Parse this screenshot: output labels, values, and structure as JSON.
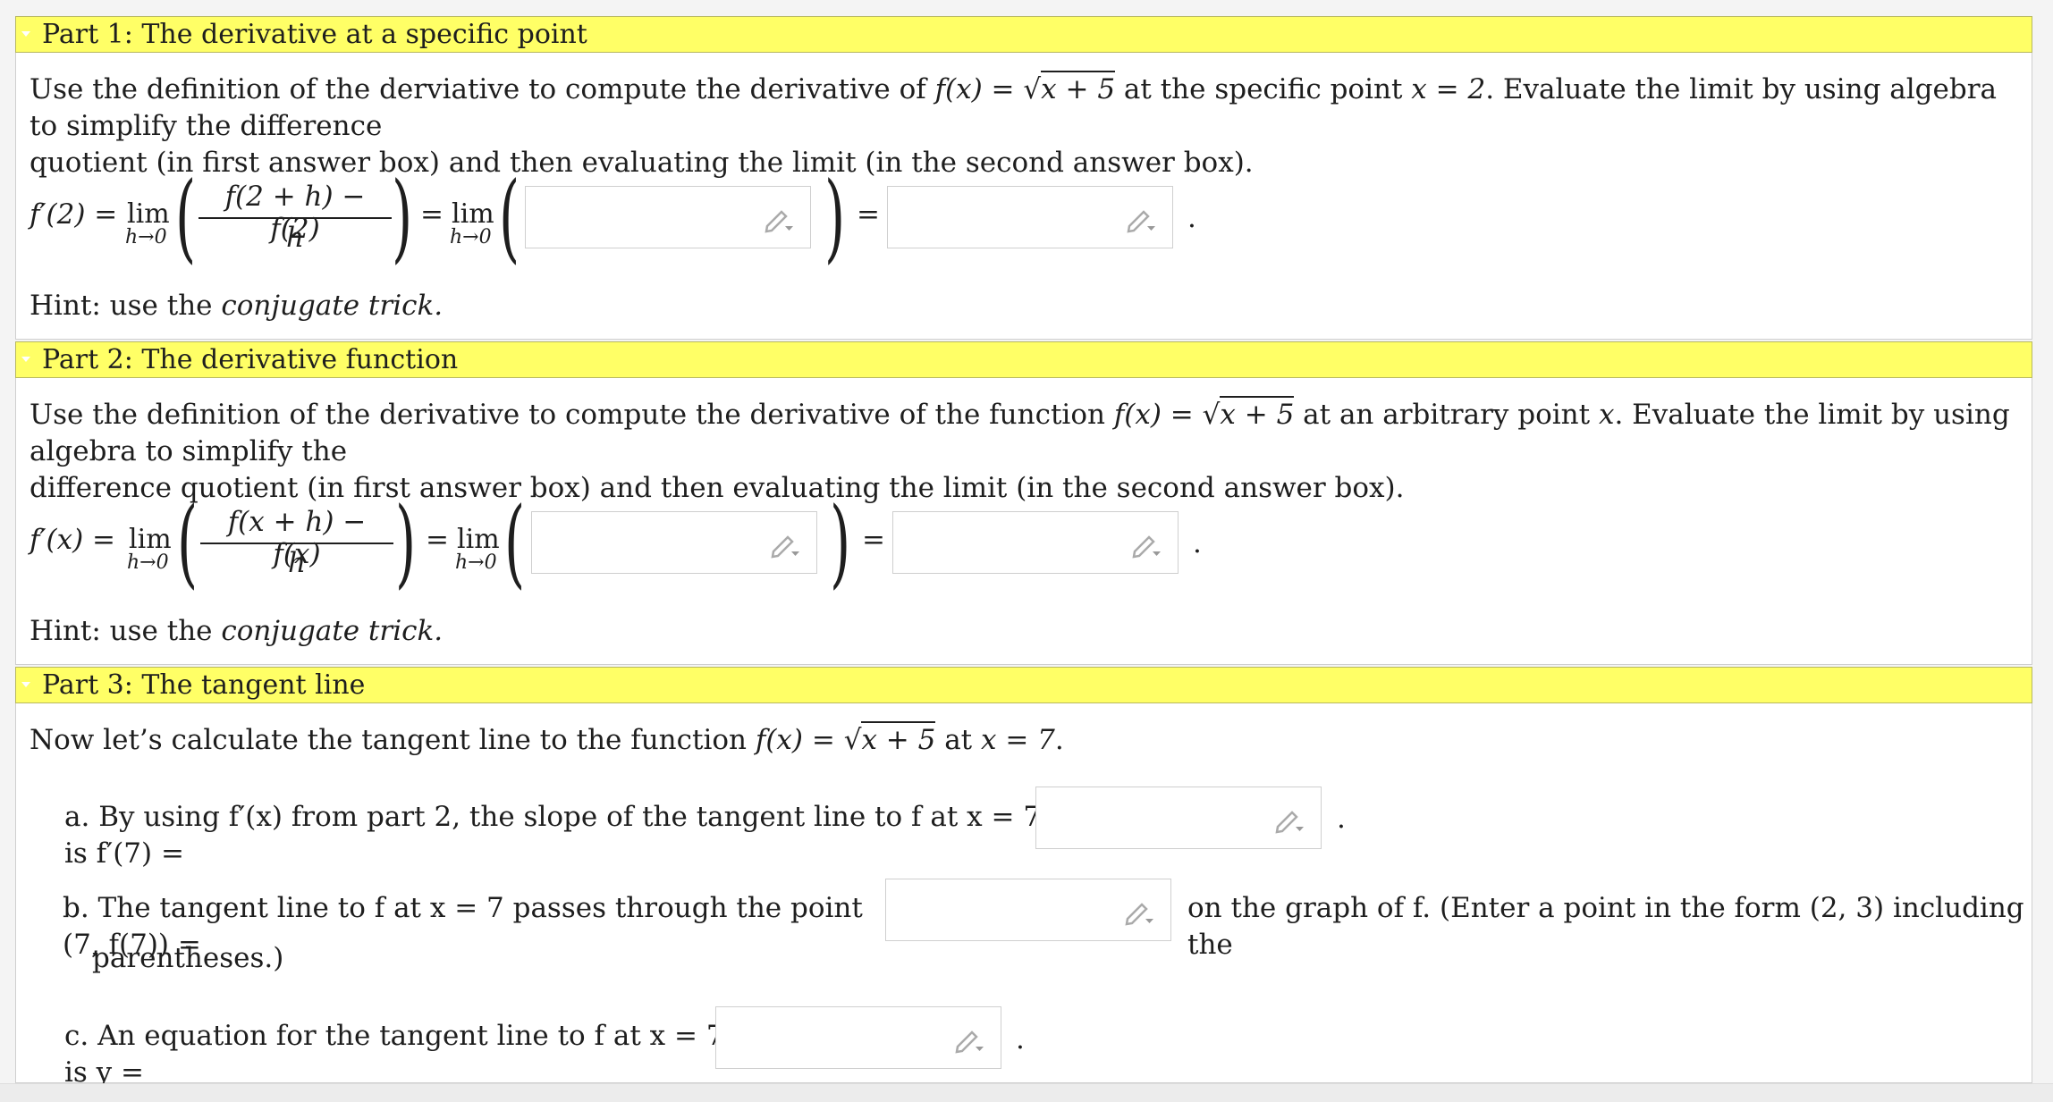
{
  "part1": {
    "header": "Part 1: The derivative at a specific point",
    "intro_a": "Use the definition of the derviative to compute the derivative of ",
    "func": "f(x) = ",
    "func_rad": "x + 5",
    "intro_b": " at the specific point ",
    "point": "x = 2",
    "intro_c": ". Evaluate the limit by using algebra to simplify the difference",
    "intro_line2": "quotient (in first answer box) and then evaluating the limit (in the second answer box).",
    "lhs": "f′(2) = ",
    "lim": "lim",
    "limsub": "h→0",
    "numerator": "f(2 + h) − f(2)",
    "denominator": "h",
    "eq": "=",
    "period": ".",
    "hint_a": "Hint: use the ",
    "hint_b": "conjugate trick."
  },
  "part2": {
    "header": "Part 2: The derivative function",
    "intro_a": "Use the definition of the derivative to compute the derivative of the function ",
    "func": "f(x) = ",
    "func_rad": "x + 5",
    "intro_b": " at an arbitrary point ",
    "point": "x",
    "intro_c": ". Evaluate the limit by using algebra to simplify the",
    "intro_line2": "difference quotient (in first answer box) and then evaluating the limit (in the second answer box).",
    "lhs": "f′(x) = ",
    "lim": "lim",
    "limsub": "h→0",
    "numerator": "f(x + h) − f(x)",
    "denominator": "h",
    "eq": "=",
    "period": ".",
    "hint_a": "Hint: use the ",
    "hint_b": "conjugate trick."
  },
  "part3": {
    "header": "Part 3: The tangent line",
    "intro_a": "Now let’s calculate the tangent line to the function ",
    "func": "f(x) = ",
    "func_rad": "x + 5",
    "intro_b": " at ",
    "point": "x = 7",
    "intro_c": ".",
    "a_text": "a. By using f′(x) from part 2, the slope of the tangent line to f at x = 7 is f′(7) =",
    "a_period": ".",
    "b_text": "b. The tangent line to f at x = 7 passes through the point (7, f(7)) =",
    "b_after": "on the graph of f. (Enter a point in the form (2, 3) including the",
    "b_line2": "parentheses.)",
    "c_text": "c. An equation for the tangent line to f at x = 7 is y =",
    "c_period": "."
  },
  "colors": {
    "header_bg": "#ffff66",
    "border": "#cfcfcf",
    "page_bg": "#f4f4f4"
  },
  "icons": {
    "answer_box": "pencil-icon"
  }
}
